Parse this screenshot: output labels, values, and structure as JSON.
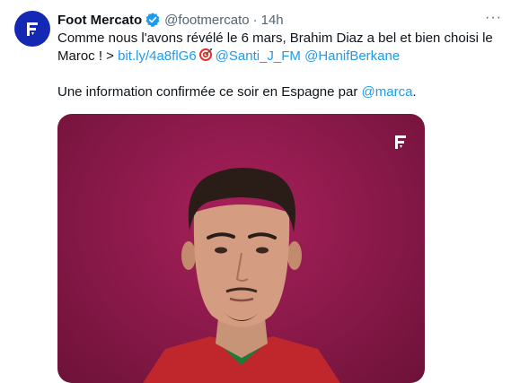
{
  "tweet": {
    "author_name": "Foot Mercato",
    "author_handle": "@footmercato",
    "separator": "·",
    "time": "14h",
    "more_icon": "more-icon",
    "text_line1": "Comme nous l'avons révélé le 6 mars, Brahim Diaz a bel et bien choisi le",
    "text_line2_prefix": "Maroc ! > ",
    "link_url": "bit.ly/4a8flG6",
    "mention1": "@Santi_J_FM",
    "mention2": "@HanifBerkane",
    "text_line3_prefix": "Une information confirmée ce soir en Espagne par ",
    "mention3": "@marca",
    "text_line3_suffix": "."
  },
  "colors": {
    "link": "#1d9bf0",
    "brand_blue": "#1428b4",
    "verified": "#1d9bf0",
    "media_background": "#8e1a4c",
    "shirt_red": "#c0272d",
    "shirt_green": "#1e7a3a"
  },
  "icons": {
    "avatar": "foot-mercato-logo-icon",
    "verified": "verified-badge-icon",
    "emoji": "direct-hit-target-icon",
    "media_watermark": "foot-mercato-logo-icon"
  }
}
